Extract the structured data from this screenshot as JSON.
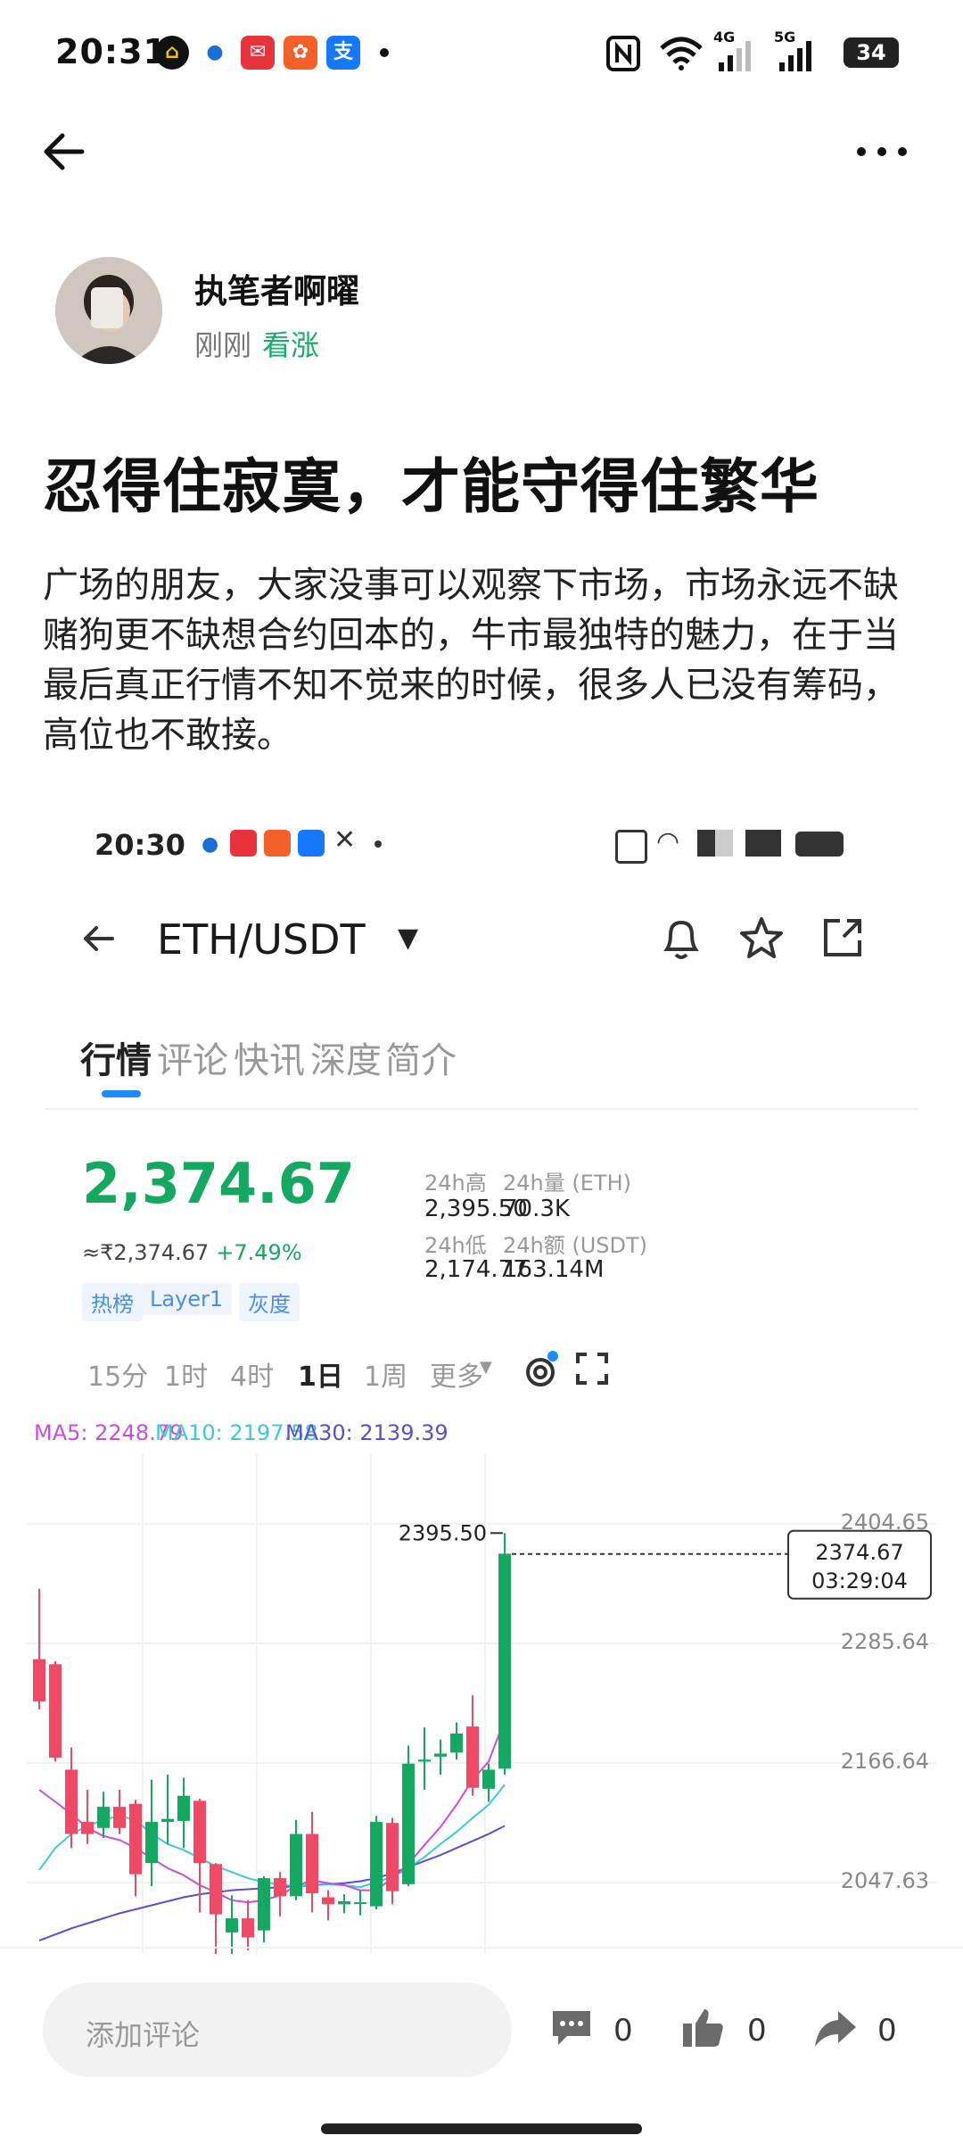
{
  "status_bar": {
    "time": "20:31",
    "battery": "34",
    "signal_4g": "4G",
    "signal_5g": "5G",
    "app_icons": [
      "app-yellow-icon",
      "drop-icon",
      "chat-ai-icon",
      "orange-app-icon",
      "alipay-icon"
    ]
  },
  "header": {
    "back_icon": "arrow-left-icon",
    "more_icon": "more-dots-icon"
  },
  "author": {
    "name": "执笔者啊曜",
    "time": "刚刚",
    "sentiment": "看涨"
  },
  "post": {
    "title": "忍得住寂寞，才能守得住繁华",
    "body": "广场的朋友，大家没事可以观察下市场，市场永远不缺赌狗更不缺想合约回本的，牛市最独特的魅力，在于当最后真正行情不知不觉来的时候，很多人已没有筹码，高位也不敢接。"
  },
  "embed": {
    "status_time": "20:30",
    "pair": "ETH/USDT",
    "tabs": [
      "行情",
      "评论",
      "快讯",
      "深度",
      "简介"
    ],
    "price": "2,374.67",
    "price_cny": "≈₹2,374.67",
    "change": "+7.49%",
    "tags": [
      "热榜",
      "Layer1",
      "灰度"
    ],
    "stats": {
      "high_label": "24h高",
      "high": "2,395.50",
      "vol_label": "24h量 (ETH)",
      "vol": "70.3K",
      "low_label": "24h低",
      "low": "2,174.77",
      "amount_label": "24h额 (USDT)",
      "amount": "163.14M"
    },
    "timeframes": [
      "15分",
      "1时",
      "4时",
      "1日",
      "1周",
      "更多"
    ],
    "active_timeframe": "1日",
    "ma": {
      "ma5": "MA5: 2248.79",
      "ma10": "MA10: 2197.58",
      "ma30": "MA30: 2139.39"
    },
    "price_levels": [
      "2404.65",
      "2285.64",
      "2166.64",
      "2047.63"
    ],
    "max_label": "2395.50",
    "current_price_box": "2374.67",
    "countdown": "03:29:04"
  },
  "bottom": {
    "comment_placeholder": "添加评论",
    "comments": "0",
    "likes": "0",
    "shares": "0"
  },
  "colors": {
    "bull_green": "#14a860",
    "bear_red": "#ef4965",
    "ma5": "#c84fd9",
    "ma10": "#3fc9d4",
    "ma30": "#5a4fcf"
  },
  "chart_data": {
    "type": "candlestick",
    "ylim": [
      2000,
      2420
    ],
    "y_ticks": [
      2404.65,
      2285.64,
      2166.64,
      2047.63
    ],
    "candles": [
      {
        "o": 2270,
        "c": 2228,
        "h": 2340,
        "l": 2220
      },
      {
        "o": 2265,
        "c": 2172,
        "h": 2268,
        "l": 2168
      },
      {
        "o": 2160,
        "c": 2096,
        "h": 2182,
        "l": 2082
      },
      {
        "o": 2108,
        "c": 2096,
        "h": 2140,
        "l": 2086
      },
      {
        "o": 2102,
        "c": 2123,
        "h": 2138,
        "l": 2092
      },
      {
        "o": 2123,
        "c": 2102,
        "h": 2140,
        "l": 2096
      },
      {
        "o": 2126,
        "c": 2056,
        "h": 2130,
        "l": 2034
      },
      {
        "o": 2067,
        "c": 2108,
        "h": 2150,
        "l": 2044
      },
      {
        "o": 2108,
        "c": 2111,
        "h": 2155,
        "l": 2086
      },
      {
        "o": 2109,
        "c": 2134,
        "h": 2152,
        "l": 2082
      },
      {
        "o": 2129,
        "c": 2067,
        "h": 2131,
        "l": 2018
      },
      {
        "o": 2066,
        "c": 2016,
        "h": 2067,
        "l": 1975
      },
      {
        "o": 1998,
        "c": 2012,
        "h": 2035,
        "l": 1975
      },
      {
        "o": 2012,
        "c": 1993,
        "h": 2030,
        "l": 1980
      },
      {
        "o": 2000,
        "c": 2052,
        "h": 2054,
        "l": 1988
      },
      {
        "o": 2052,
        "c": 2034,
        "h": 2058,
        "l": 2014
      },
      {
        "o": 2034,
        "c": 2096,
        "h": 2110,
        "l": 2030
      },
      {
        "o": 2096,
        "c": 2037,
        "h": 2118,
        "l": 2018
      },
      {
        "o": 2033,
        "c": 2026,
        "h": 2040,
        "l": 2010
      },
      {
        "o": 2026,
        "c": 2029,
        "h": 2036,
        "l": 2017
      },
      {
        "o": 2028,
        "c": 2028,
        "h": 2040,
        "l": 2015
      },
      {
        "o": 2024,
        "c": 2108,
        "h": 2114,
        "l": 2021
      },
      {
        "o": 2107,
        "c": 2039,
        "h": 2112,
        "l": 2026
      },
      {
        "o": 2046,
        "c": 2166,
        "h": 2184,
        "l": 2044
      },
      {
        "o": 2168,
        "c": 2170,
        "h": 2202,
        "l": 2140
      },
      {
        "o": 2173,
        "c": 2176,
        "h": 2190,
        "l": 2155
      },
      {
        "o": 2177,
        "c": 2196,
        "h": 2207,
        "l": 2170
      },
      {
        "o": 2203,
        "c": 2142,
        "h": 2234,
        "l": 2134
      },
      {
        "o": 2141,
        "c": 2160,
        "h": 2166,
        "l": 2128
      },
      {
        "o": 2161,
        "c": 2375,
        "h": 2395.5,
        "l": 2155
      }
    ],
    "ma5_series": [
      2140,
      2128,
      2116,
      2102,
      2094,
      2090,
      2082,
      2072,
      2062,
      2055,
      2045,
      2038,
      2030,
      2028,
      2030,
      2035,
      2044,
      2050,
      2047,
      2045,
      2040,
      2040,
      2052,
      2066,
      2085,
      2103,
      2125,
      2150,
      2168,
      2210
    ],
    "ma10_series": [
      2060,
      2082,
      2096,
      2104,
      2110,
      2114,
      2110,
      2096,
      2086,
      2080,
      2072,
      2064,
      2058,
      2052,
      2048,
      2046,
      2044,
      2046,
      2046,
      2045,
      2043,
      2048,
      2053,
      2062,
      2073,
      2086,
      2098,
      2112,
      2125,
      2145
    ],
    "ma30_series": [
      1990,
      1996,
      2002,
      2007,
      2012,
      2017,
      2021,
      2025,
      2029,
      2033,
      2036,
      2038,
      2040,
      2041,
      2042,
      2043,
      2044,
      2045,
      2046,
      2047,
      2049,
      2052,
      2057,
      2063,
      2069,
      2075,
      2082,
      2089,
      2096,
      2104
    ]
  }
}
